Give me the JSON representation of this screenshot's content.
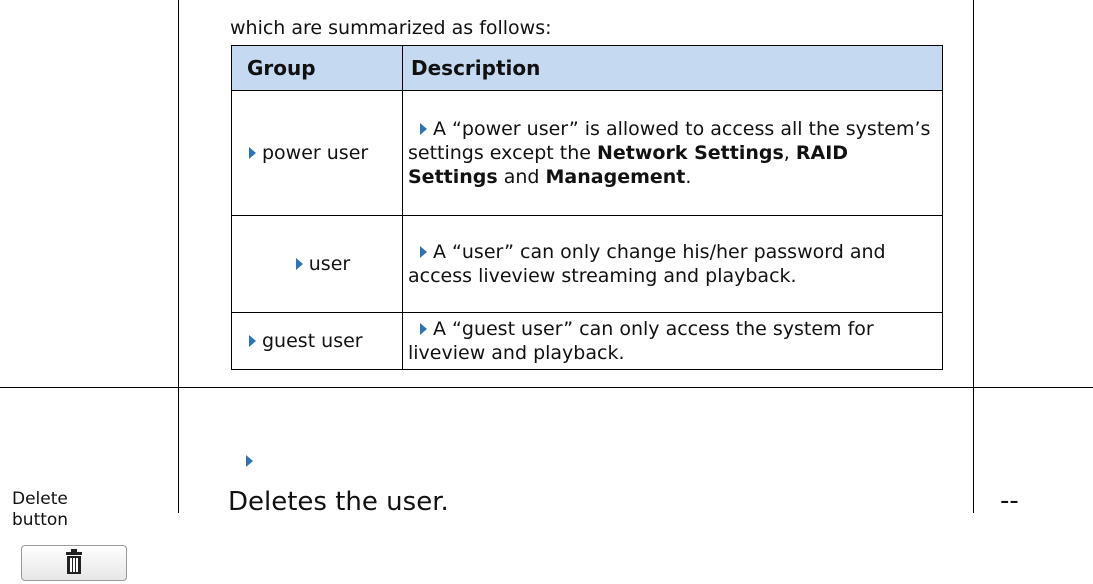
{
  "intro_text": "which are summarized as follows:",
  "table": {
    "headers": [
      "Group",
      "Description"
    ],
    "rows": [
      {
        "group": "power user",
        "desc_plain_1": "A “power user” is allowed to access all the system’s settings except the ",
        "desc_bold_1": "Network Settings",
        "desc_plain_2": ", ",
        "desc_bold_2": "RAID Settings",
        "desc_plain_3": " and ",
        "desc_bold_3": "Management",
        "desc_plain_4": "."
      },
      {
        "group": "user",
        "desc": "A “user” can only change his/her password and access liveview streaming and playback."
      },
      {
        "group": "guest user",
        "desc": "A “guest user” can only access the system for liveview and playback."
      }
    ]
  },
  "delete": {
    "label_line1": "Delete",
    "label_line2": "button",
    "description": "Deletes the user.",
    "value": "--",
    "icon": "trash-can-icon"
  },
  "colors": {
    "header_bg": "#c5d9f1",
    "bullet": "#2e74b5"
  }
}
